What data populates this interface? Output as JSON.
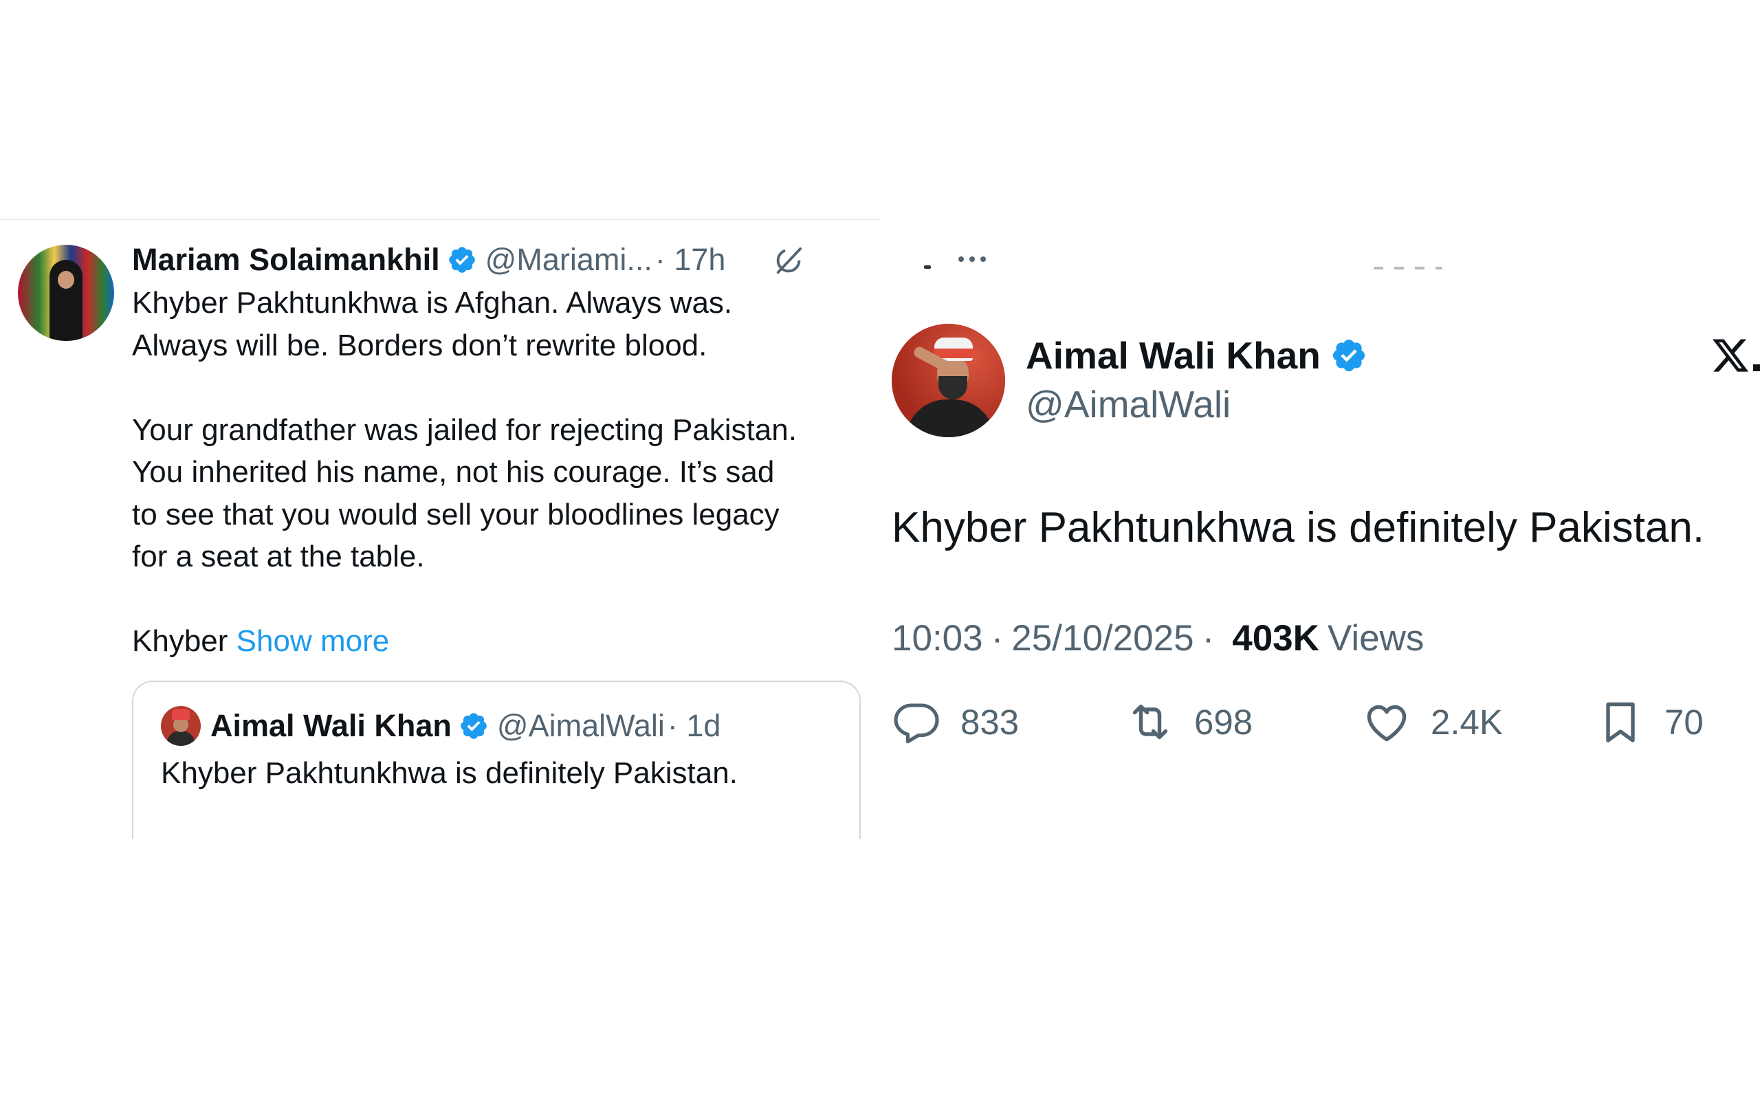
{
  "left_tweet": {
    "author_name": "Mariam Solaimankhil",
    "handle": "@Mariami...",
    "time": "· 17h",
    "body_lines": [
      "Khyber Pakhtunkhwa is Afghan. Always was.",
      "Always will be. Borders don’t rewrite blood.",
      "Your grandfather was jailed for rejecting Pakistan.",
      "You inherited his name, not his courage. It’s sad",
      "to see that you would sell your bloodlines legacy",
      "for a seat at the table.",
      "Khyber"
    ],
    "show_more": "Show more",
    "quoted": {
      "author_name": "Aimal Wali Khan",
      "handle": "@AimalWali",
      "time": "· 1d",
      "text": "Khyber Pakhtunkhwa is definitely Pakistan."
    }
  },
  "right_tweet": {
    "author_name": "Aimal Wali Khan",
    "handle": "@AimalWali",
    "text": "Khyber Pakhtunkhwa is definitely Pakistan.",
    "time": "10:03",
    "date": "25/10/2025",
    "views_count": "403K",
    "views_label": "Views",
    "stats": {
      "replies": "833",
      "retweets": "698",
      "likes": "2.4K",
      "bookmarks": "70"
    }
  },
  "icons": {
    "verified": "verified-badge-icon",
    "grok": "grok-icon",
    "more": "more-options-icon",
    "brand": "x-logo-icon",
    "reply": "reply-icon",
    "retweet": "retweet-icon",
    "like": "like-icon",
    "bookmark": "bookmark-icon"
  },
  "colors": {
    "text": "#0f1419",
    "secondary": "#536471",
    "link": "#1d9bf0",
    "verified": "#1d9bf0",
    "border": "#cfd9de"
  }
}
